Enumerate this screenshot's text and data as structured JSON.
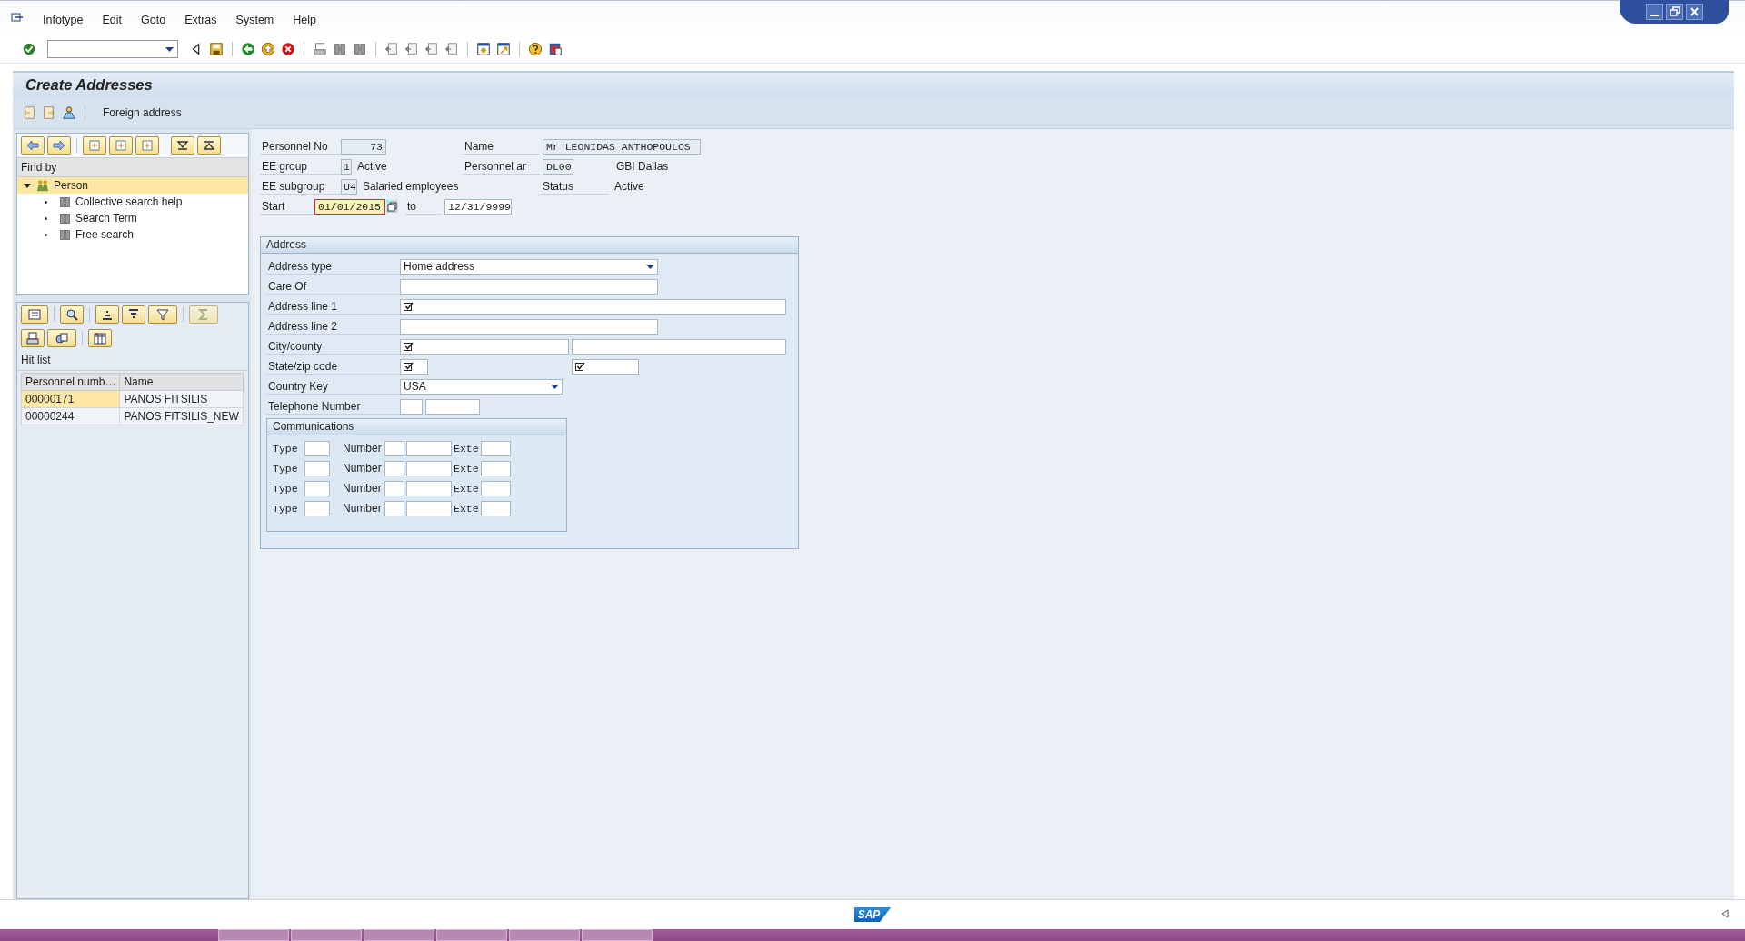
{
  "menu": [
    "Infotype",
    "Edit",
    "Goto",
    "Extras",
    "System",
    "Help"
  ],
  "title": "Create Addresses",
  "app_toolbar": {
    "button": "Foreign address"
  },
  "find_by": {
    "header": "Find by",
    "tree": [
      {
        "label": "Person",
        "expanded": true,
        "selected": true,
        "children": [
          {
            "label": "Collective search help"
          },
          {
            "label": "Search Term"
          },
          {
            "label": "Free search"
          }
        ]
      }
    ]
  },
  "hit_list": {
    "title": "Hit list",
    "columns": [
      "Personnel numb…",
      "Name"
    ],
    "rows": [
      {
        "cells": [
          "00000171",
          "PANOS FITSILIS"
        ],
        "selected": true
      },
      {
        "cells": [
          "00000244",
          "PANOS FITSILIS_NEW"
        ],
        "selected": false
      }
    ]
  },
  "header": {
    "personnel_no": {
      "label": "Personnel No",
      "value": "73"
    },
    "name": {
      "label": "Name",
      "value": "Mr LEONIDAS ANTHOPOULOS"
    },
    "ee_group": {
      "label": "EE group",
      "code": "1",
      "text": "Active"
    },
    "personnel_area": {
      "label": "Personnel ar",
      "code": "DL00",
      "text": "GBI Dallas"
    },
    "ee_subgroup": {
      "label": "EE subgroup",
      "code": "U4",
      "text": "Salaried employees"
    },
    "status": {
      "label": "Status",
      "text": "Active"
    },
    "start": {
      "label": "Start",
      "value": "01/01/2015",
      "focused": true,
      "to_label": "to",
      "to_value": "12/31/9999"
    }
  },
  "address": {
    "title": "Address",
    "rows": [
      {
        "label": "Address type",
        "fields": [
          {
            "kind": "dropdown",
            "value": "Home address"
          }
        ]
      },
      {
        "label": "Care Of",
        "fields": [
          {
            "kind": "input",
            "required": false
          }
        ]
      },
      {
        "label": "Address line 1",
        "fields": [
          {
            "kind": "input",
            "required": true
          }
        ]
      },
      {
        "label": "Address line 2",
        "fields": [
          {
            "kind": "input",
            "required": false
          }
        ]
      },
      {
        "label": "City/county",
        "fields": [
          {
            "kind": "input",
            "required": true
          },
          {
            "kind": "input",
            "required": false
          }
        ]
      },
      {
        "label": "State/zip code",
        "fields": [
          {
            "kind": "input",
            "required": true
          },
          {
            "kind": "input",
            "required": true
          }
        ]
      },
      {
        "label": "Country Key",
        "fields": [
          {
            "kind": "dropdown",
            "value": "USA"
          }
        ]
      },
      {
        "label": "Telephone Number",
        "fields": [
          {
            "kind": "input",
            "required": false
          },
          {
            "kind": "input",
            "required": false
          }
        ]
      }
    ]
  },
  "communications": {
    "title": "Communications",
    "rows": [
      {
        "type_label": "Type",
        "number_label": "Number",
        "ext_label": "Exte"
      },
      {
        "type_label": "Type",
        "number_label": "Number",
        "ext_label": "Exte"
      },
      {
        "type_label": "Type",
        "number_label": "Number",
        "ext_label": "Exte"
      },
      {
        "type_label": "Type",
        "number_label": "Number",
        "ext_label": "Exte"
      }
    ]
  },
  "footer": {
    "logo": "SAP"
  }
}
